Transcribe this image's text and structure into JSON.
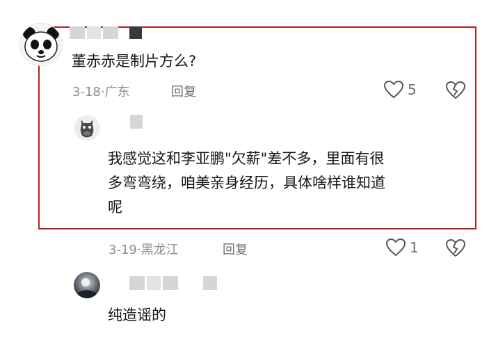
{
  "comments": [
    {
      "text": "董赤赤是制片方么?",
      "date": "3-18",
      "location": "广东",
      "reply_label": "回复",
      "likes": "5"
    },
    {
      "text_line1": "我感觉这和李亚鹏\"欠薪\"差不多，里面有很",
      "text_line2": "多弯弯绕，咱美亲身经历，具体啥样谁知道",
      "text_line3": "呢",
      "date": "3-19",
      "location": "黑龙江",
      "reply_label": "回复",
      "likes": "1"
    },
    {
      "text": "纯造谣的"
    }
  ],
  "separator": "·",
  "colors": {
    "highlight_border": "#b51f1f",
    "meta_text": "#8e8e8e"
  },
  "icons": [
    "panda-avatar",
    "horse-avatar",
    "night-avatar",
    "heart-icon",
    "broken-heart-icon"
  ]
}
